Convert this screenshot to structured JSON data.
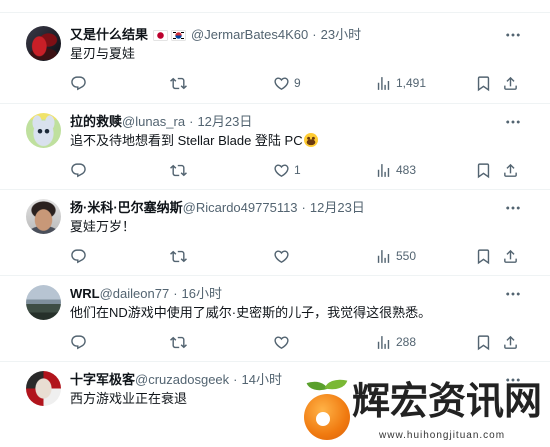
{
  "colors": {
    "text": "#0f1419",
    "muted": "#536471",
    "divider": "#eff3f4"
  },
  "more_icon": "more-icon",
  "action_bar": [
    {
      "key": "reply",
      "icon": "reply-icon"
    },
    {
      "key": "retweet",
      "icon": "retweet-icon"
    },
    {
      "key": "like",
      "icon": "heart-icon"
    },
    {
      "key": "views",
      "icon": "views-icon"
    },
    {
      "key": "bookmark",
      "icon": "bookmark-icon"
    },
    {
      "key": "share",
      "icon": "share-icon"
    }
  ],
  "tweets": [
    {
      "name": "又是什么结果",
      "name_flags": [
        "japan-flag-icon",
        "south-korea-flag-icon"
      ],
      "handle": "@JermarBates4K60",
      "separator": "·",
      "time": "23小时",
      "text": "星刃与夏娃",
      "actions": {
        "like": "9",
        "views": "1,491"
      }
    },
    {
      "name": "拉的救赎",
      "handle": "@lunas_ra",
      "separator": "·",
      "time": "12月23日",
      "text": "追不及待地想看到 Stellar Blade 登陆 PC",
      "text_emoji": "grinning-face-icon",
      "actions": {
        "like": "1",
        "views": "483"
      }
    },
    {
      "name": "扬·米科·巴尔塞纳斯",
      "handle": "@Ricardo49775113",
      "separator": "·",
      "time": "12月23日",
      "text": "夏娃万岁！",
      "actions": {
        "views": "550"
      }
    },
    {
      "name": "WRL",
      "handle": "@daileon77",
      "separator": "·",
      "time": "16小时",
      "text": "他们在ND游戏中使用了威尔·史密斯的儿子，我觉得这很熟悉。",
      "actions": {
        "views": "288"
      }
    },
    {
      "name": "十字军极客",
      "handle": "@cruzadosgeek",
      "separator": "·",
      "time": "14小时",
      "text": "西方游戏业正在衰退"
    }
  ],
  "watermark": {
    "title": "辉宏资讯网",
    "url": "www.huihongjituan.com",
    "logo_icon": "watermark-logo-icon"
  }
}
